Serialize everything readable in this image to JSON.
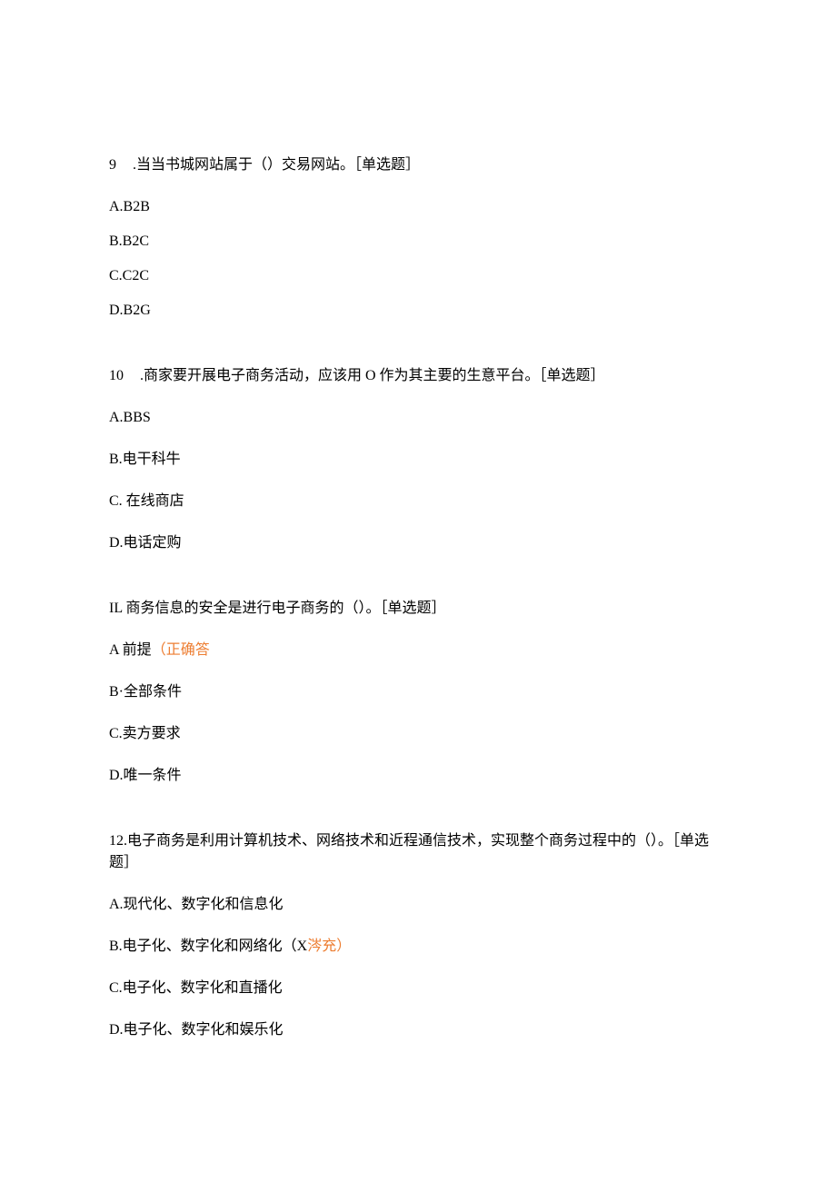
{
  "questions": [
    {
      "number": "9",
      "stem": ".当当书城网站属于（）交易网站。［单选题］",
      "options": [
        {
          "text": "A.B2B"
        },
        {
          "text": "B.B2C"
        },
        {
          "text": "C.C2C"
        },
        {
          "text": "D.B2G"
        }
      ],
      "tight": true
    },
    {
      "number": "10",
      "stem": ".商家要开展电子商务活动，应该用 O 作为其主要的生意平台。［单选题］",
      "options": [
        {
          "text": "A.BBS"
        },
        {
          "text": "B.电干科牛"
        },
        {
          "text": "C. 在线商店"
        },
        {
          "text": "D.电话定购"
        }
      ],
      "tight": false
    },
    {
      "number_raw": "IL",
      "stem": "商务信息的安全是进行电子商务的（）。［单选题］",
      "options": [
        {
          "text": "A 前提",
          "hint": "（正确答"
        },
        {
          "text": "B·全部条件"
        },
        {
          "text": "C.卖方要求"
        },
        {
          "text": "D.唯一条件"
        }
      ],
      "tight": false
    },
    {
      "number_raw": "12.",
      "stem": "电子商务是利用计算机技术、网络技术和近程通信技术，实现整个商务过程中的（）。［单选题］",
      "options": [
        {
          "text": "A.现代化、数字化和信息化"
        },
        {
          "text": "B.电子化、数字化和网络化（X",
          "hint": "涔充）"
        },
        {
          "text": "C.电子化、数字化和直播化"
        },
        {
          "text": "D.电子化、数字化和娱乐化"
        }
      ],
      "tight": false
    }
  ]
}
